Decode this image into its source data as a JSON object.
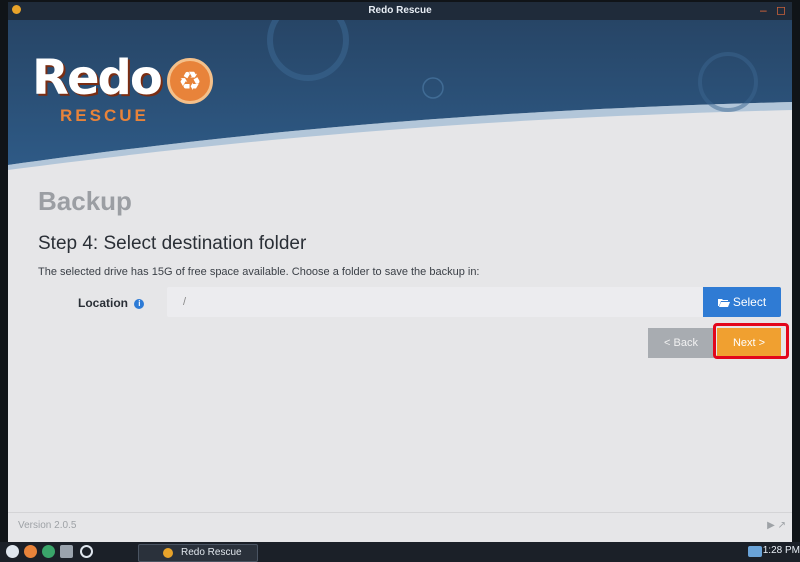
{
  "titlebar": {
    "title": "Redo Rescue",
    "minimize_glyph": "–",
    "close_glyph": "◻"
  },
  "logo": {
    "word": "Redo",
    "subword": "RESCUE",
    "badge_glyph": "♻"
  },
  "page": {
    "heading": "Backup",
    "step_title": "Step 4: Select destination folder",
    "description": "The selected drive has 15G of free space available. Choose a folder to save the backup in:",
    "location_label": "Location",
    "info_glyph": "i",
    "location_value": "/",
    "select_label": "Select",
    "select_icon": "folder-open-icon",
    "back_label": "< Back",
    "next_label": "Next >"
  },
  "footer": {
    "version": "Version 2.0.5",
    "icons": "▶ ↗"
  },
  "taskbar": {
    "task_label": "Redo Rescue",
    "clock": "1:28 PM"
  },
  "colors": {
    "accent_blue": "#2f7bd4",
    "accent_orange": "#f0a030",
    "highlight_red": "#e3061b",
    "header_navy": "#1f3a5c"
  }
}
